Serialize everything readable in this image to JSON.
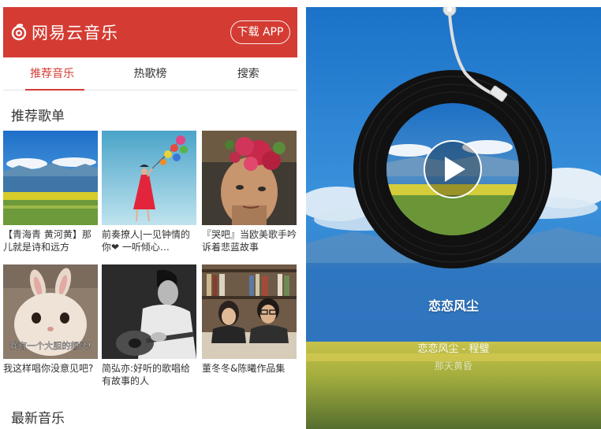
{
  "header": {
    "brand": "网易云音乐",
    "download_label": "下载 APP"
  },
  "tabs": [
    {
      "label": "推荐音乐"
    },
    {
      "label": "热歌榜"
    },
    {
      "label": "搜索"
    }
  ],
  "sections": {
    "recommended_playlists": "推荐歌单",
    "latest_music": "最新音乐"
  },
  "playlists": [
    {
      "caption": "【青海青 黄河黄】那儿就是诗和远方",
      "thumb": "qinghai-landscape"
    },
    {
      "caption": "前奏撩人|一见钟情的你❤ 一听倾心…",
      "thumb": "girl-balloons"
    },
    {
      "caption": "『哭吧』当欧美歌手吟诉着悲蓝故事",
      "thumb": "flowers-portrait"
    },
    {
      "caption": "我这样唱你没意见吧?",
      "thumb": "rabbit",
      "overlay_text": "我有一个大胆的想法!"
    },
    {
      "caption": "简弘亦:好听的歌唱给有故事的人",
      "thumb": "guitar-man"
    },
    {
      "caption": "董冬冬&陈曦作品集",
      "thumb": "duo-bookshelf"
    }
  ],
  "player": {
    "song_title": "恋恋风尘",
    "song_artist": "恋恋风尘 - 程璧",
    "next_line": "那天黄昏",
    "play_state": "paused"
  },
  "colors": {
    "brand_red": "#d43c33"
  }
}
